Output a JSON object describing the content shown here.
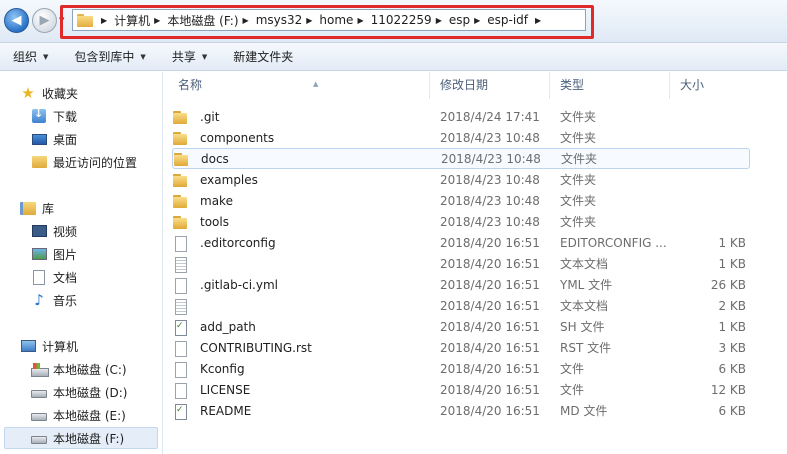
{
  "address_bar": {
    "breadcrumbs": [
      "计算机",
      "本地磁盘 (F:)",
      "msys32",
      "home",
      "11022259",
      "esp",
      "esp-idf"
    ]
  },
  "toolbar": {
    "organize": "组织",
    "include_in_library": "包含到库中",
    "share": "共享",
    "new_folder": "新建文件夹"
  },
  "sidebar": {
    "favorites": {
      "label": "收藏夹",
      "items": [
        "下载",
        "桌面",
        "最近访问的位置"
      ]
    },
    "libraries": {
      "label": "库",
      "items": [
        "视频",
        "图片",
        "文档",
        "音乐"
      ]
    },
    "computer": {
      "label": "计算机",
      "items": [
        "本地磁盘 (C:)",
        "本地磁盘 (D:)",
        "本地磁盘 (E:)",
        "本地磁盘 (F:)"
      ],
      "selected": "本地磁盘 (F:)"
    }
  },
  "columns": {
    "name": "名称",
    "date": "修改日期",
    "type": "类型",
    "size": "大小"
  },
  "files": [
    {
      "name": ".git",
      "date": "2018/4/24 17:41",
      "type": "文件夹",
      "size": "",
      "icon": "folder-icon"
    },
    {
      "name": "components",
      "date": "2018/4/23 10:48",
      "type": "文件夹",
      "size": "",
      "icon": "folder-icon"
    },
    {
      "name": "docs",
      "date": "2018/4/23 10:48",
      "type": "文件夹",
      "size": "",
      "icon": "folder-icon"
    },
    {
      "name": "examples",
      "date": "2018/4/23 10:48",
      "type": "文件夹",
      "size": "",
      "icon": "folder-icon"
    },
    {
      "name": "make",
      "date": "2018/4/23 10:48",
      "type": "文件夹",
      "size": "",
      "icon": "folder-icon"
    },
    {
      "name": "tools",
      "date": "2018/4/23 10:48",
      "type": "文件夹",
      "size": "",
      "icon": "folder-icon"
    },
    {
      "name": ".editorconfig",
      "date": "2018/4/20 16:51",
      "type": "EDITORCONFIG ...",
      "size": "1 KB",
      "icon": "file-icon"
    },
    {
      "name": "",
      "date": "2018/4/20 16:51",
      "type": "文本文档",
      "size": "1 KB",
      "icon": "text-file-icon"
    },
    {
      "name": ".gitlab-ci.yml",
      "date": "2018/4/20 16:51",
      "type": "YML 文件",
      "size": "26 KB",
      "icon": "file-icon"
    },
    {
      "name": "",
      "date": "2018/4/20 16:51",
      "type": "文本文档",
      "size": "2 KB",
      "icon": "text-file-icon"
    },
    {
      "name": "add_path",
      "date": "2018/4/20 16:51",
      "type": "SH 文件",
      "size": "1 KB",
      "icon": "script-file-icon"
    },
    {
      "name": "CONTRIBUTING.rst",
      "date": "2018/4/20 16:51",
      "type": "RST 文件",
      "size": "3 KB",
      "icon": "file-icon"
    },
    {
      "name": "Kconfig",
      "date": "2018/4/20 16:51",
      "type": "文件",
      "size": "6 KB",
      "icon": "file-icon"
    },
    {
      "name": "LICENSE",
      "date": "2018/4/20 16:51",
      "type": "文件",
      "size": "12 KB",
      "icon": "file-icon"
    },
    {
      "name": "README",
      "date": "2018/4/20 16:51",
      "type": "MD 文件",
      "size": "6 KB",
      "icon": "script-file-icon"
    }
  ]
}
